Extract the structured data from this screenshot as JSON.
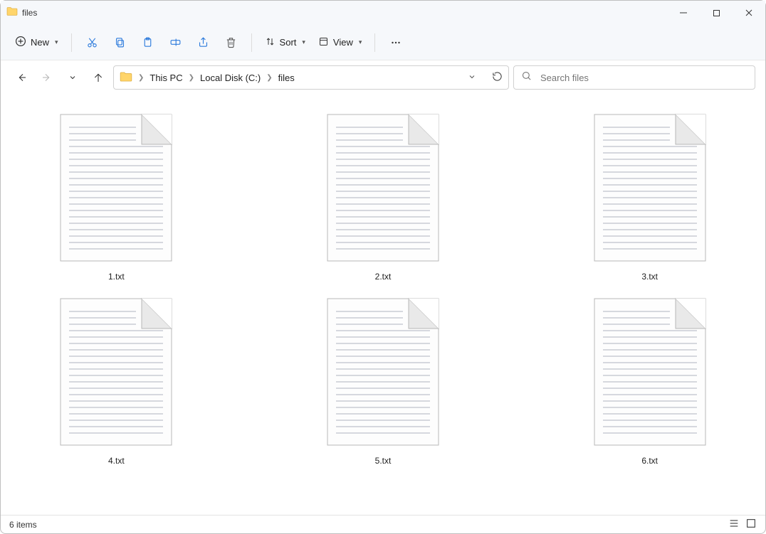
{
  "window": {
    "title": "files"
  },
  "toolbar": {
    "new_label": "New",
    "sort_label": "Sort",
    "view_label": "View"
  },
  "breadcrumb": {
    "seg0": "This PC",
    "seg1": "Local Disk (C:)",
    "seg2": "files"
  },
  "search": {
    "placeholder": "Search files"
  },
  "files": {
    "0": {
      "name": "1.txt"
    },
    "1": {
      "name": "2.txt"
    },
    "2": {
      "name": "3.txt"
    },
    "3": {
      "name": "4.txt"
    },
    "4": {
      "name": "5.txt"
    },
    "5": {
      "name": "6.txt"
    }
  },
  "status": {
    "count": "6 items"
  }
}
